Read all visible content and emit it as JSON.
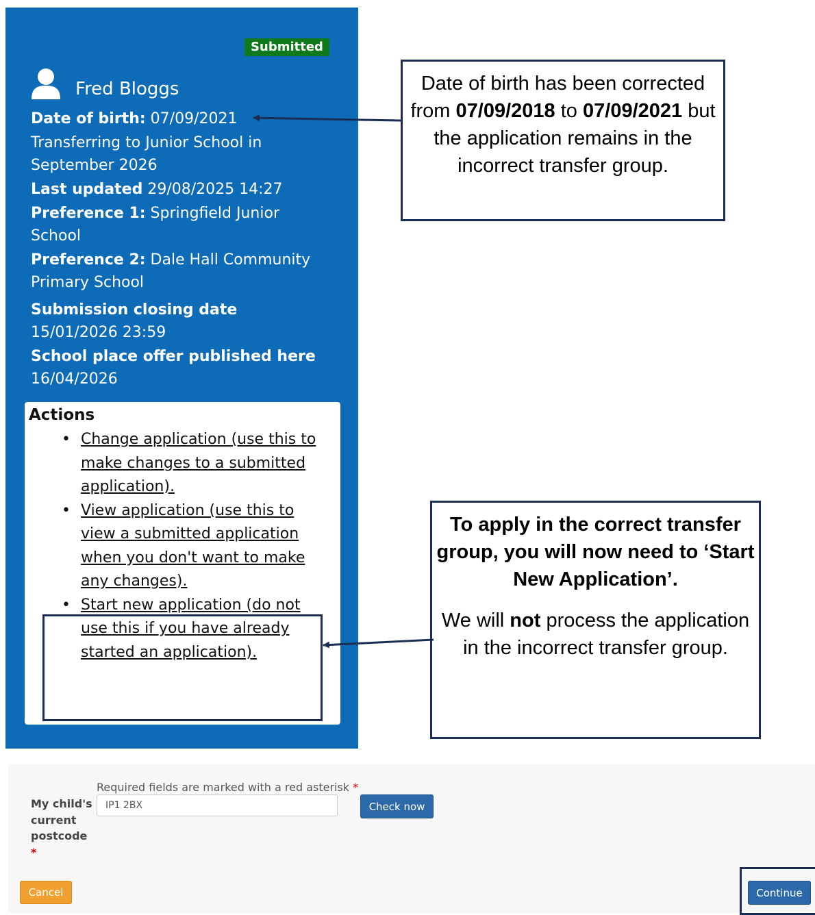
{
  "card": {
    "status_badge": "Submitted",
    "child_name": "Fred Bloggs",
    "dob_label": "Date of birth:",
    "dob_value": " 07/09/2021",
    "transfer_line1": "Transferring to Junior School in",
    "transfer_line2": "September 2026",
    "last_updated_label": "Last updated",
    "last_updated_value": " 29/08/2025 14:27",
    "pref1_label": "Preference 1:",
    "pref1_value_l1": " Springfield Junior",
    "pref1_value_l2": "School",
    "pref2_label": "Preference 2:",
    "pref2_value_l1": " Dale Hall Community",
    "pref2_value_l2": "Primary School",
    "closing_label": "Submission closing date",
    "closing_value": "15/01/2026 23:59",
    "offer_label": "School place offer published here",
    "offer_value": " 16/04/2026"
  },
  "actions": {
    "title": "Actions",
    "items": [
      {
        "label": "Change application (use this to make changes to a submitted application)."
      },
      {
        "label": "View application (use this to view a submitted application when you don't want to make any changes)."
      },
      {
        "label": "Start new application (do not use this if you have already started an application)."
      }
    ]
  },
  "callout_dob": {
    "t1": "Date of birth has been corrected from ",
    "b1": "07/09/2018",
    "t2": " to ",
    "b2": "07/09/2021",
    "t3": " but the application remains in the incorrect transfer group."
  },
  "callout_new": {
    "bold_text": "To apply in the correct transfer group, you will now need to ‘Start New Application’.",
    "t1": "We will ",
    "b1": "not",
    "t2": " process the application in the incorrect transfer group."
  },
  "form": {
    "required_note": "Required fields are marked with a red asterisk ",
    "asterisk": "*",
    "postcode_label": "My child's current postcode",
    "postcode_value": "IP1 2BX",
    "check_button": "Check now",
    "cancel_button": "Cancel",
    "continue_button": "Continue"
  },
  "colors": {
    "card_blue": "#0d6bb7",
    "badge_green": "#0f7a1c",
    "callout_border": "#1c2d54",
    "button_blue": "#2b69a9",
    "button_orange": "#f0a030"
  }
}
